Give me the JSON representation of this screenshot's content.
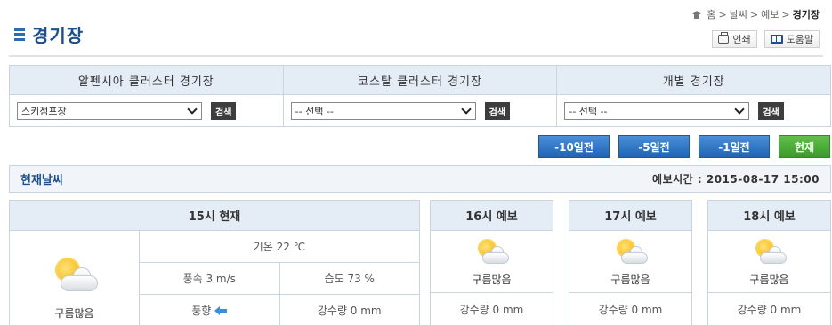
{
  "header": {
    "title": "경기장",
    "breadcrumb": [
      "홈",
      ">",
      "날씨",
      ">",
      "예보",
      ">",
      "경기장"
    ],
    "print_label": "인쇄",
    "help_label": "도움말"
  },
  "selectors": [
    {
      "heading": "알펜시아 클러스터 경기장",
      "selected": "스키점프장",
      "search_label": "검색"
    },
    {
      "heading": "코스탈 클러스터 경기장",
      "selected": "-- 선택 --",
      "search_label": "검색"
    },
    {
      "heading": "개별 경기장",
      "selected": "-- 선택 --",
      "search_label": "검색"
    }
  ],
  "period_buttons": [
    "-10일전",
    "-5일전",
    "-1일전",
    "현재"
  ],
  "current": {
    "label": "현재날씨",
    "forecast_time": "예보시간 : 2015-08-17 15:00"
  },
  "now": {
    "heading": "15시 현재",
    "condition": "구름많음",
    "condition_icon": "partly-cloudy-icon",
    "temperature": "기온 22 ℃",
    "wind_speed": "풍속 3 m/s",
    "humidity": "습도 73 %",
    "wind_direction_label": "풍향",
    "wind_direction_icon": "arrow-left-icon",
    "precipitation": "강수량 0 mm"
  },
  "forecasts": [
    {
      "heading": "16시 예보",
      "condition": "구름많음",
      "precipitation": "강수량 0 mm"
    },
    {
      "heading": "17시 예보",
      "condition": "구름많음",
      "precipitation": "강수량 0 mm"
    },
    {
      "heading": "18시 예보",
      "condition": "구름많음",
      "precipitation": "강수량 0 mm"
    }
  ],
  "colors": {
    "accent_blue": "#1f64b4",
    "now_green": "#3b9a2a",
    "header_bg": "#e4ecf5"
  }
}
